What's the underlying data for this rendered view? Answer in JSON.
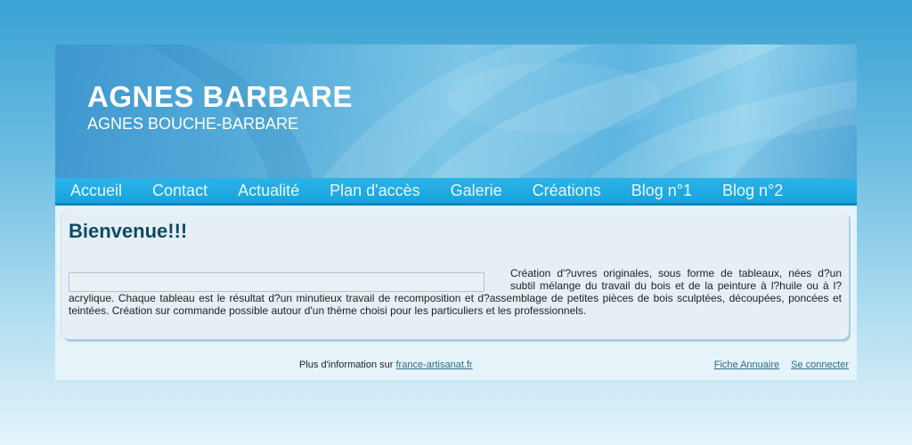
{
  "header": {
    "title": "AGNES BARBARE",
    "subtitle": "AGNES BOUCHE-BARBARE"
  },
  "nav": {
    "items": [
      {
        "label": "Accueil"
      },
      {
        "label": "Contact"
      },
      {
        "label": "Actualité"
      },
      {
        "label": "Plan d'accès"
      },
      {
        "label": "Galerie"
      },
      {
        "label": "Créations"
      },
      {
        "label": "Blog n°1"
      },
      {
        "label": "Blog n°2"
      }
    ]
  },
  "content": {
    "title": "Bienvenue!!!",
    "body": "Création d'?uvres originales, sous forme de tableaux, nées d?un subtil mélange du travail du bois et de la peinture à l?huile ou à l?acrylique. Chaque tableau est le résultat d?un minutieux travail de recomposition et d?assemblage de petites pièces de bois sculptées, découpées, poncées et teintées. Création sur commande possible autour d'un thème choisi pour les particuliers et les professionnels."
  },
  "footer": {
    "info_text": "Plus d'information sur ",
    "info_link": "france-artisanat.fr",
    "directory_link": "Fiche Annuaire",
    "login_link": "Se connecter"
  },
  "colors": {
    "nav_background": "#17a3df",
    "title_color": "#0d4a66",
    "link_color": "#2c6a8a"
  }
}
